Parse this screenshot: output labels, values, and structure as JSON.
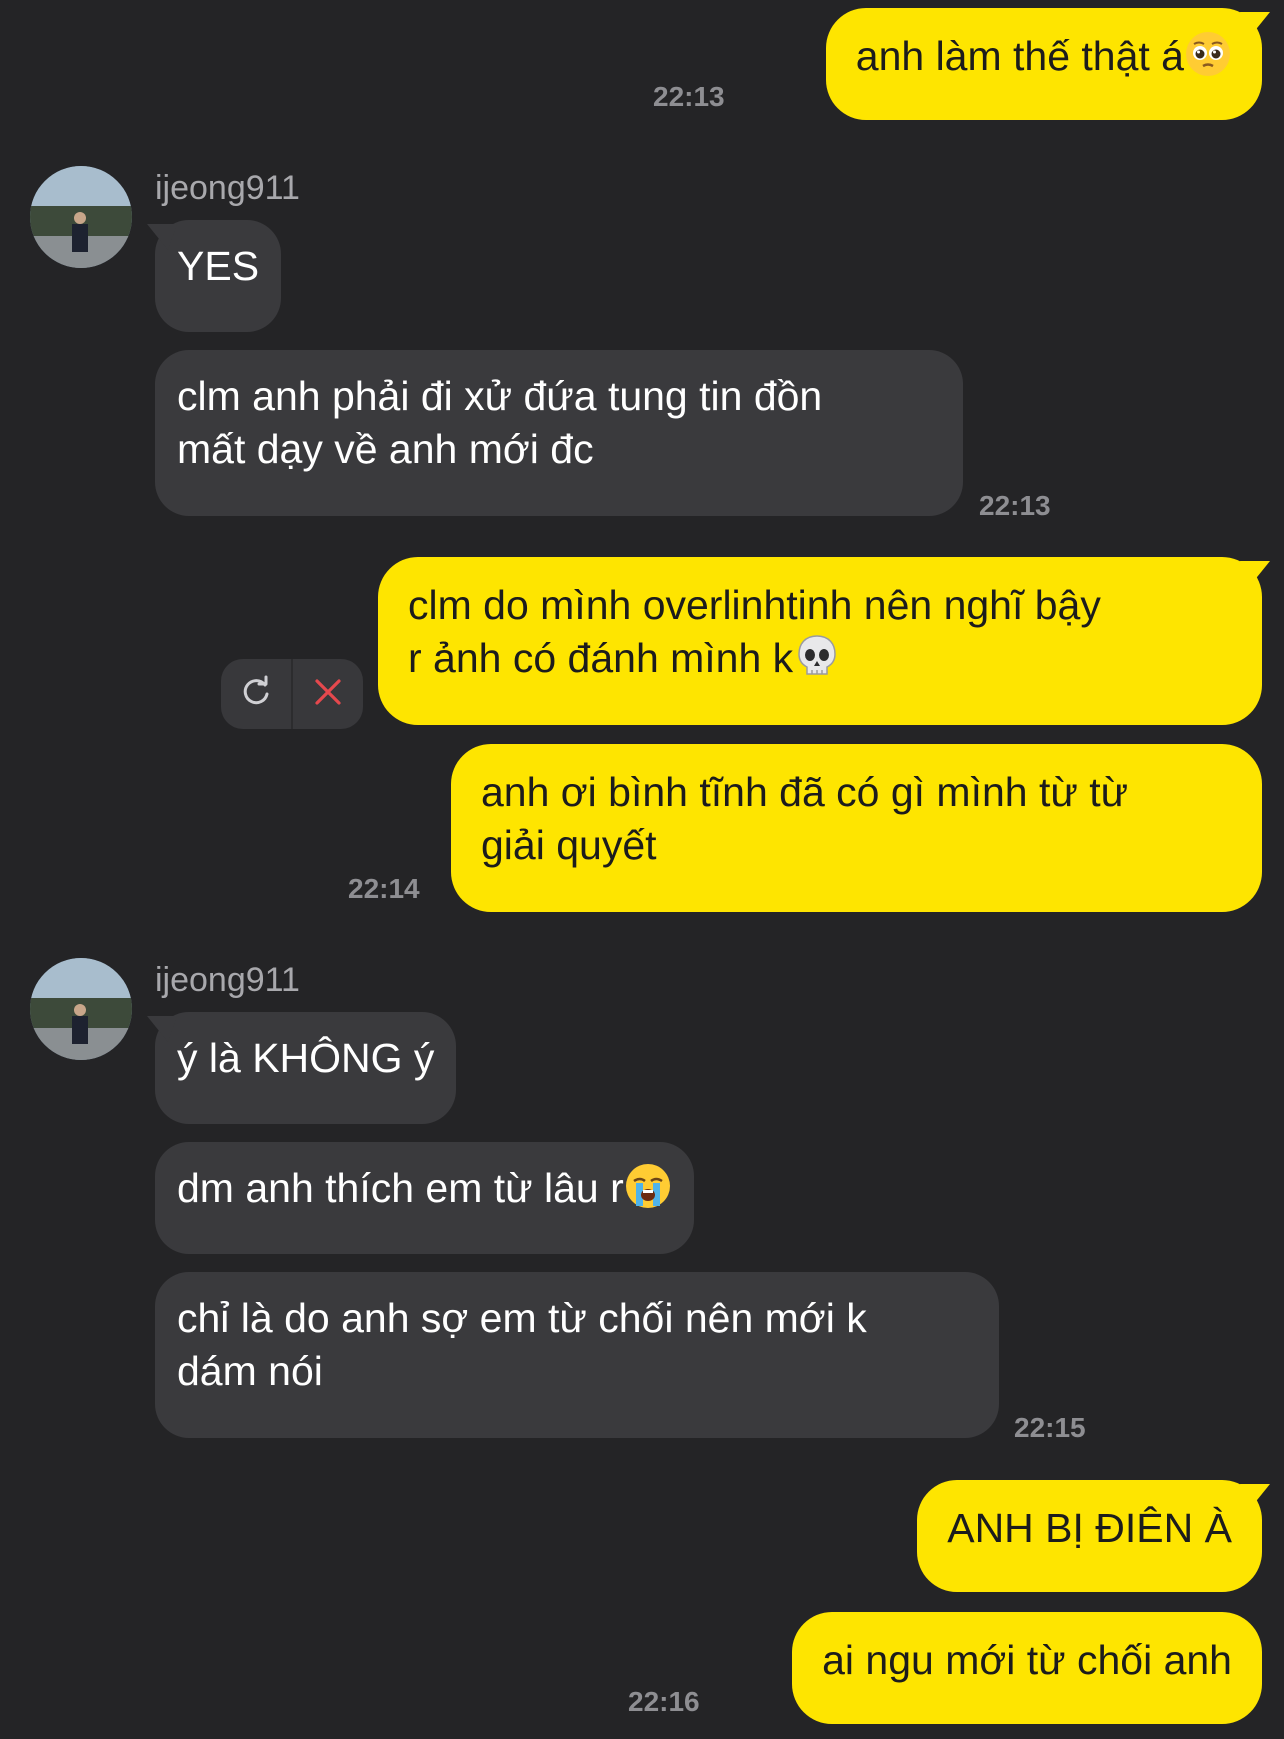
{
  "contact": {
    "name": "ijeong911"
  },
  "messages": [
    {
      "id": "m1",
      "side": "out",
      "text": "anh làm thế thật á",
      "emoji": "pleading-face",
      "time": "22:13"
    },
    {
      "id": "m2",
      "side": "in",
      "text": "YES"
    },
    {
      "id": "m3",
      "side": "in",
      "lines": [
        "clm anh phải đi xử đứa tung tin đồn",
        "mất dạy về anh mới đc"
      ],
      "time": "22:13"
    },
    {
      "id": "m4",
      "side": "out",
      "lines": [
        "clm do mình overlinhtinh nên nghĩ bậy",
        "r ảnh có đánh mình k"
      ],
      "emoji": "skull",
      "status": "failed"
    },
    {
      "id": "m5",
      "side": "out",
      "lines": [
        "anh ơi bình tĩnh đã có gì mình từ từ",
        "giải quyết"
      ],
      "time": "22:14"
    },
    {
      "id": "m6",
      "side": "in",
      "text": "ý là KHÔNG ý"
    },
    {
      "id": "m7",
      "side": "in",
      "text": "dm anh thích em từ lâu r",
      "emoji": "loudly-crying-face"
    },
    {
      "id": "m8",
      "side": "in",
      "lines": [
        "chỉ là do anh sợ em từ chối nên mới k",
        "dám nói"
      ],
      "time": "22:15"
    },
    {
      "id": "m9",
      "side": "out",
      "text": "ANH BỊ ĐIÊN À"
    },
    {
      "id": "m10",
      "side": "out",
      "text": "ai ngu mới từ chối anh",
      "time": "22:16"
    }
  ],
  "colors": {
    "background": "#242426",
    "incoming_bubble": "#3a3a3d",
    "outgoing_bubble": "#fee500",
    "timestamp": "#8e8e92",
    "error": "#e5484d"
  },
  "icons": {
    "retry": "retry-icon",
    "delete": "close-icon"
  }
}
